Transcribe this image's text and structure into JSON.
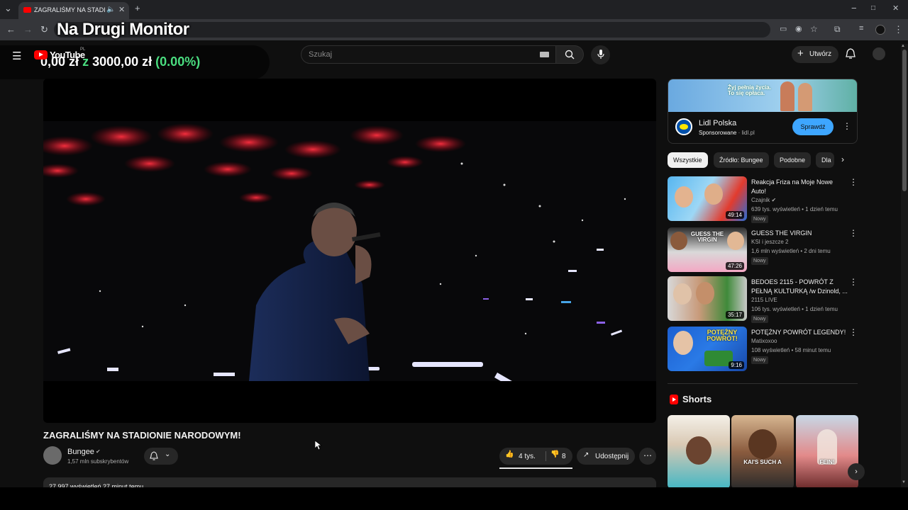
{
  "browser": {
    "tab_title": "ZAGRALIŚMY NA STADIONIE NARODOWYM!",
    "tab_audio_icon": "speaker-icon",
    "new_tab_label": "+",
    "window_controls": [
      "−",
      "□",
      "✕"
    ]
  },
  "overlay": {
    "title": "Na Drugi Monitor",
    "amount": "0,00 zł",
    "of_word": "z",
    "goal": "3000,00 zł",
    "percent": "(0.00%)",
    "accent_color": "#4ade80"
  },
  "header": {
    "logo_text": "YouTube",
    "region": "PL",
    "search_placeholder": "Szukaj",
    "create_label": "Utwórz"
  },
  "video": {
    "title": "ZAGRALIŚMY NA STADIONIE NARODOWYM!",
    "channel_name": "Bungee",
    "subscribers": "1,57 mln subskrybentów",
    "likes": "4 tys.",
    "dislikes": "8",
    "share_label": "Udostępnij",
    "description_preview": "27 997 wyświetleń  27 minut temu"
  },
  "ad": {
    "slogan_line1": "Żyj pełnią życia.",
    "slogan_line2": "To się opłaca.",
    "advertiser": "Lidl Polska",
    "sponsored_label": "Sponsorowane",
    "domain": "lidl.pl",
    "cta": "Sprawdź"
  },
  "chips": [
    "Wszystkie",
    "Źródło: Bungee",
    "Podobne",
    "Dla"
  ],
  "recommendations": [
    {
      "title": "Reakcja Friza na Moje Nowe Auto!",
      "channel": "Czajnik",
      "verified": true,
      "meta": "639 tys. wyświetleń • 1 dzień temu",
      "badge": "Nowy",
      "duration": "49:14"
    },
    {
      "title": "GUESS THE VIRGIN",
      "channel": "KSI i jeszcze 2",
      "verified": false,
      "meta": "1,6 mln wyświetleń • 2 dni temu",
      "badge": "Nowy",
      "duration": "47:26",
      "thumb_text": "GUESS THE VIRGIN"
    },
    {
      "title": "BEDOES 2115 - POWRÓT Z PEŁNĄ KULTURKĄ /w Dzinold, ...",
      "channel": "2115 LIVE",
      "verified": false,
      "meta": "106 tys. wyświetleń • 1 dzień temu",
      "badge": "Nowy",
      "duration": "35:17"
    },
    {
      "title": "POTĘŻNY POWRÓT LEGENDY!",
      "channel": "Matixoxoo",
      "verified": false,
      "meta": "108 wyświetleń • 58 minut temu",
      "badge": "Nowy",
      "duration": "9:16",
      "thumb_text": "POTĘŻNY POWRÓT!"
    }
  ],
  "shorts": {
    "label": "Shorts",
    "items": [
      {
        "caption": ""
      },
      {
        "caption": "KAI'S SUCH A"
      },
      {
        "caption": "FEIN!"
      }
    ]
  }
}
